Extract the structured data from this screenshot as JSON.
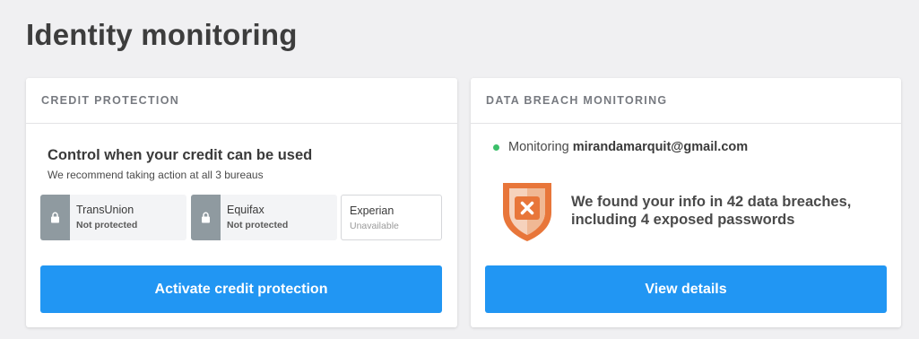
{
  "page": {
    "title": "Identity monitoring"
  },
  "credit": {
    "header": "CREDIT PROTECTION",
    "heading": "Control when your credit can be used",
    "subtext": "We recommend taking action at all 3 bureaus",
    "bureaus": [
      {
        "name": "TransUnion",
        "status": "Not protected",
        "icon": "lock-icon"
      },
      {
        "name": "Equifax",
        "status": "Not protected",
        "icon": "lock-icon"
      },
      {
        "name": "Experian",
        "status": "Unavailable"
      }
    ],
    "button_label": "Activate credit protection"
  },
  "breach": {
    "header": "DATA BREACH MONITORING",
    "monitoring_label": "Monitoring",
    "email": "mirandamarquit@gmail.com",
    "message_line1": "We found your info in 42 data breaches,",
    "message_line2": "including 4 exposed passwords",
    "icon": "shield-alert-icon",
    "button_label": "View details"
  },
  "colors": {
    "accent": "#2196f3",
    "status_ok": "#3cbf6a",
    "alert": "#e8763a",
    "lock_bg": "#8f9aa0"
  }
}
